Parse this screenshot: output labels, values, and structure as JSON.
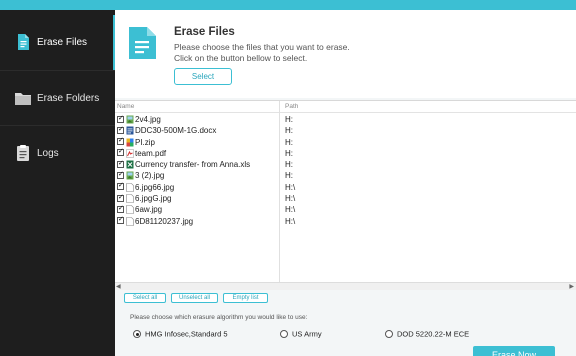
{
  "sidebar": {
    "items": [
      {
        "label": "Erase Files",
        "icon": "file-icon",
        "active": true
      },
      {
        "label": "Erase Folders",
        "icon": "folder-icon",
        "active": false
      },
      {
        "label": "Logs",
        "icon": "log-icon",
        "active": false
      }
    ]
  },
  "header": {
    "title": "Erase Files",
    "desc_line1": "Please choose the files that you want to erase.",
    "desc_line2": "Click on the button bellow to select.",
    "select_label": "Select"
  },
  "table": {
    "columns": {
      "name": "Name",
      "path": "Path"
    },
    "rows": [
      {
        "name": "2v4.jpg",
        "path": "H:",
        "type": "image",
        "checked": true
      },
      {
        "name": "DDC30-500M-1G.docx",
        "path": "H:",
        "type": "doc",
        "checked": true
      },
      {
        "name": "PI.zip",
        "path": "H:",
        "type": "zip",
        "checked": true
      },
      {
        "name": "team.pdf",
        "path": "H:",
        "type": "pdf",
        "checked": true
      },
      {
        "name": "Currency transfer- from Anna.xls",
        "path": "H:",
        "type": "xls",
        "checked": true
      },
      {
        "name": "3 (2).jpg",
        "path": "H:",
        "type": "image",
        "checked": true
      },
      {
        "name": "6.jpg66.jpg",
        "path": "H:\\",
        "type": "blank",
        "checked": true
      },
      {
        "name": "6.jpgG.jpg",
        "path": "H:\\",
        "type": "blank",
        "checked": true
      },
      {
        "name": "6aw.jpg",
        "path": "H:\\",
        "type": "blank",
        "checked": true
      },
      {
        "name": "6D81120237.jpg",
        "path": "H:\\",
        "type": "blank",
        "checked": true
      }
    ]
  },
  "actions": {
    "select_all": "Select all",
    "unselect_all": "Unselect all",
    "empty_list": "Empty list"
  },
  "algorithm": {
    "label": "Please choose which erasure algorithm you would like to use:",
    "options": [
      {
        "label": "HMG Infosec,Standard 5",
        "selected": true
      },
      {
        "label": "US Army",
        "selected": false
      },
      {
        "label": "DOD 5220.22-M ECE",
        "selected": false
      }
    ]
  },
  "erase_button": "Erase Now",
  "colors": {
    "accent": "#3cbfd3",
    "sidebar_bg": "#1e1e1e"
  }
}
